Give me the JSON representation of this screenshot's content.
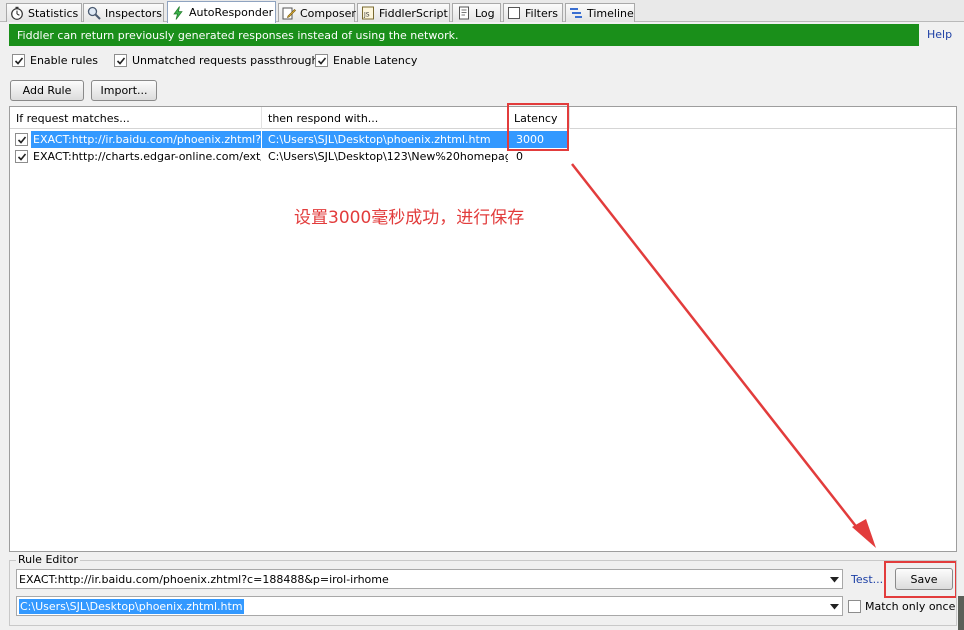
{
  "tabs": [
    {
      "label": "Statistics",
      "icon": "stopwatch-icon"
    },
    {
      "label": "Inspectors",
      "icon": "magnifier-icon"
    },
    {
      "label": "AutoResponder",
      "icon": "lightning-icon",
      "active": true
    },
    {
      "label": "Composer",
      "icon": "pencil-icon"
    },
    {
      "label": "FiddlerScript",
      "icon": "script-icon"
    },
    {
      "label": "Log",
      "icon": "document-icon"
    },
    {
      "label": "Filters",
      "icon": "checkbox-icon"
    },
    {
      "label": "Timeline",
      "icon": "timeline-icon"
    }
  ],
  "banner": {
    "text": "Fiddler can return previously generated responses instead of using the network.",
    "help": "Help",
    "color": "#1a8f1a"
  },
  "options": {
    "enable_rules": "Enable rules",
    "unmatched_passthrough": "Unmatched requests passthrough",
    "enable_latency": "Enable Latency"
  },
  "buttons": {
    "add_rule": "Add Rule",
    "import": "Import..."
  },
  "list": {
    "headers": {
      "match": "If request matches...",
      "respond": "then respond with...",
      "latency": "Latency"
    },
    "rows": [
      {
        "match": "EXACT:http://ir.baidu.com/phoenix.zhtml?c...",
        "respond": "C:\\Users\\SJL\\Desktop\\phoenix.zhtml.htm",
        "latency": "3000"
      },
      {
        "match": "EXACT:http://charts.edgar-online.com/ext/c...",
        "respond": "C:\\Users\\SJL\\Desktop\\123\\New%20homepage...",
        "latency": "0"
      }
    ]
  },
  "annotation": {
    "text": "设置3000毫秒成功，进行保存",
    "color": "#e23c3c"
  },
  "rule_editor": {
    "label": "Rule Editor",
    "match_value": "EXACT:http://ir.baidu.com/phoenix.zhtml?c=188488&p=irol-irhome",
    "respond_value": "C:\\Users\\SJL\\Desktop\\phoenix.zhtml.htm",
    "test": "Test...",
    "save": "Save",
    "match_only_once": "Match only once"
  }
}
